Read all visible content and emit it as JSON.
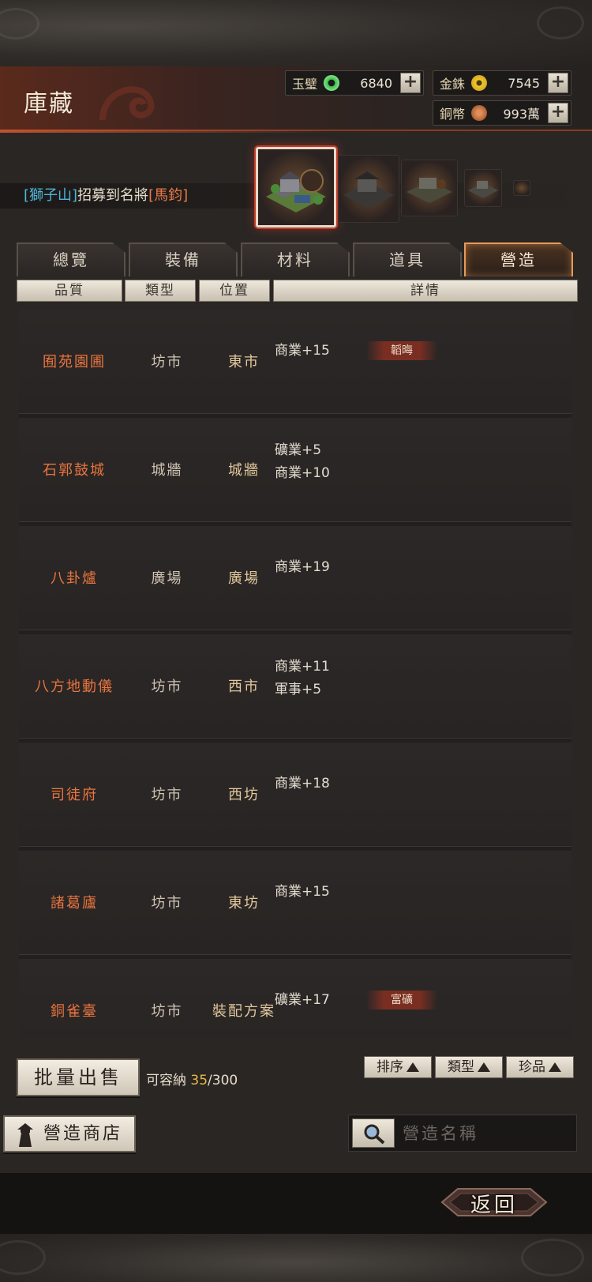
{
  "header": {
    "title": "庫藏",
    "currencies": [
      {
        "label": "玉璧",
        "value": "6840",
        "icon": "jade-disc-icon",
        "color": "#3cbf4a"
      },
      {
        "label": "金銖",
        "value": "7545",
        "icon": "gold-coin-icon",
        "color": "#d8a820"
      },
      {
        "label": "銅幣",
        "value": "993萬",
        "icon": "copper-coin-icon",
        "color": "#b86a3a"
      }
    ],
    "plus_label": "+"
  },
  "notice": {
    "open1": "[",
    "place": "獅子山",
    "close1": "]",
    "middle": "招募到名將",
    "open2": "[",
    "general": "馬鈞",
    "close2": "]"
  },
  "tabs": [
    {
      "label": "總覽",
      "active": false
    },
    {
      "label": "裝備",
      "active": false
    },
    {
      "label": "材料",
      "active": false
    },
    {
      "label": "道具",
      "active": false
    },
    {
      "label": "營造",
      "active": true
    }
  ],
  "columns": [
    "品質",
    "類型",
    "位置",
    "詳情"
  ],
  "rows": [
    {
      "name": "囿苑園圃",
      "type": "坊市",
      "location": "東市",
      "details": [
        "商業+15"
      ],
      "tag": "韜晦"
    },
    {
      "name": "石郭鼓城",
      "type": "城牆",
      "location": "城牆",
      "details": [
        "礦業+5",
        "商業+10"
      ],
      "tag": ""
    },
    {
      "name": "八卦爐",
      "type": "廣場",
      "location": "廣場",
      "details": [
        "商業+19"
      ],
      "tag": ""
    },
    {
      "name": "八方地動儀",
      "type": "坊市",
      "location": "西市",
      "details": [
        "商業+11",
        "軍事+5"
      ],
      "tag": ""
    },
    {
      "name": "司徒府",
      "type": "坊市",
      "location": "西坊",
      "details": [
        "商業+18"
      ],
      "tag": ""
    },
    {
      "name": "諸葛廬",
      "type": "坊市",
      "location": "東坊",
      "details": [
        "商業+15"
      ],
      "tag": ""
    },
    {
      "name": "銅雀臺",
      "type": "坊市",
      "location": "裝配方案",
      "details": [
        "礦業+17"
      ],
      "tag": "富礦"
    }
  ],
  "bulk_sell_label": "批量出售",
  "capacity": {
    "label": "可容納",
    "current": "35",
    "separator": "/",
    "max": "300"
  },
  "sort_buttons": [
    "排序",
    "類型",
    "珍品"
  ],
  "shop_label": "營造商店",
  "search": {
    "placeholder": "營造名稱",
    "value": ""
  },
  "back_label": "返回"
}
